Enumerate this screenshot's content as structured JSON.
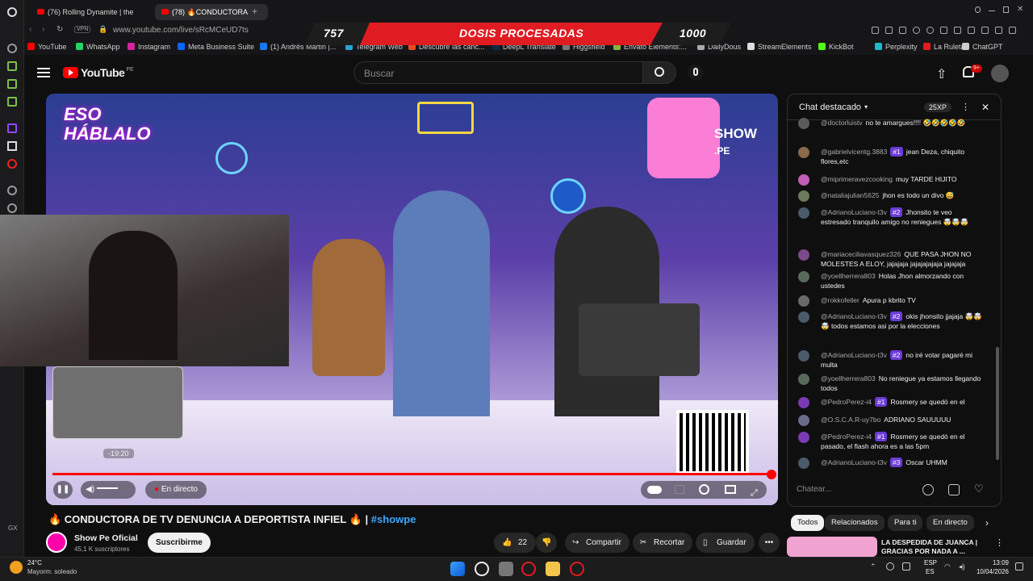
{
  "browser": {
    "tabs": [
      {
        "label": "(76) Rolling Dynamite | the"
      },
      {
        "label": "(78) 🔥CONDUCTORA"
      }
    ],
    "address": {
      "url": "www.youtube.com/live/sRcMCeUD7ts",
      "vpn": "VPN"
    },
    "bookmarks": [
      "YouTube",
      "WhatsApp",
      "Instagram",
      "Meta Business Suite",
      "(1) Andrés Martin |...",
      "Telegram Web",
      "Descubre las canc...",
      "DeepL Translate",
      "Higgsfield",
      "Envato Elements:...",
      "DailyDous",
      "StreamElements",
      "KickBot",
      "Perplexity",
      "La Ruleta",
      "ChatGPT"
    ]
  },
  "overlay": {
    "left_value": "757",
    "center_text": "DOSIS PROCESADAS",
    "right_value": "1000"
  },
  "youtube": {
    "logo": "YouTube",
    "region": "PE",
    "search_placeholder": "Buscar",
    "notification_count": "9+"
  },
  "player": {
    "time_label": "-19:20",
    "live_label": "En directo"
  },
  "video": {
    "title": "🔥 CONDUCTORA DE TV DENUNCIA A DEPORTISTA INFIEL 🔥 | ",
    "hashtag": "#showpe",
    "channel_name": "Show Pe Oficial",
    "subscribers": "45,1 K suscriptores",
    "subscribe_label": "Suscribirme",
    "likes": "22",
    "share_label": "Compartir",
    "clip_label": "Recortar",
    "save_label": "Guardar",
    "more_label": "•••"
  },
  "chat": {
    "title": "Chat destacado",
    "xp": "25XP",
    "input_placeholder": "Chatear...",
    "messages": [
      {
        "user": "@doctorluistv",
        "badge": "",
        "text": "no te amargues!!!! 🤣🤣🤣🤣🤣",
        "color": "#5a5a5a"
      },
      {
        "user": "@gabrielvicentg.3883",
        "badge": "#1",
        "text": "jean Deza, chiquito flores,etc",
        "color": "#8a6a4a"
      },
      {
        "user": "@miprimeravezcooking",
        "badge": "",
        "text": "muy TARDE HIJITO",
        "color": "#c25cb5"
      },
      {
        "user": "@nataliajulian5625",
        "badge": "",
        "text": "jhon es todo un divo 😅",
        "color": "#6a7a5a"
      },
      {
        "user": "@AdrianoLuciano-t3v",
        "badge": "#2",
        "text": "Jhonsito te veo estresado tranquilo amigo no reniegues 🤯🤯🤯",
        "color": "#4a5a6a"
      },
      {
        "user": "@mariaceciliavasquez326",
        "badge": "",
        "text": "QUE PASA JHON NO MOLESTES A ELOY, jajajaja jajajajajaja jajajaja",
        "color": "#7a4a8a"
      },
      {
        "user": "@yoellherrera803",
        "badge": "",
        "text": "Holas Jhon almorzando con ustedes",
        "color": "#5a6a5a"
      },
      {
        "user": "@rokkofeller",
        "badge": "",
        "text": "Apura p kbrito TV",
        "color": "#6a6a6a"
      },
      {
        "user": "@AdrianoLuciano-t3v",
        "badge": "#2",
        "text": "okis jhonsito jjajaja 🤯🤯🤯 todos estamos asi por la elecciones",
        "color": "#4a5a6a"
      },
      {
        "user": "@AdrianoLuciano-t3v",
        "badge": "#2",
        "text": "no iré votar pagaré mi multa",
        "color": "#4a5a6a"
      },
      {
        "user": "@yoellherrera803",
        "badge": "",
        "text": "No reniegue ya estamos llegando todos",
        "color": "#5a6a5a"
      },
      {
        "user": "@PedroPerez-i4",
        "badge": "#1",
        "text": "Rosmery se quedó en el",
        "color": "#7a3ab5"
      },
      {
        "user": "@O.S.C.A.R-uy7bo",
        "badge": "",
        "text": "ADRIANO SAUUUUU",
        "color": "#6a6a8a"
      },
      {
        "user": "@PedroPerez-i4",
        "badge": "#1",
        "text": "Rosmery se quedó en el pasado, el flash ahora es a las 5pm",
        "color": "#7a3ab5"
      },
      {
        "user": "@AdrianoLuciano-t3v",
        "badge": "#3",
        "text": "Oscar UHMM",
        "color": "#4a5a6a"
      }
    ]
  },
  "chips": [
    "Todos",
    "Relacionados",
    "Para ti",
    "En directo"
  ],
  "recommended": {
    "title": "LA DESPEDIDA DE JUANCA | GRACIAS POR NADA A ..."
  },
  "taskbar": {
    "weather_temp": "24°C",
    "weather_desc": "Mayorm. soleado",
    "lang_top": "ESP",
    "lang_bottom": "ES",
    "time": "13:09",
    "date": "10/04/2026"
  }
}
